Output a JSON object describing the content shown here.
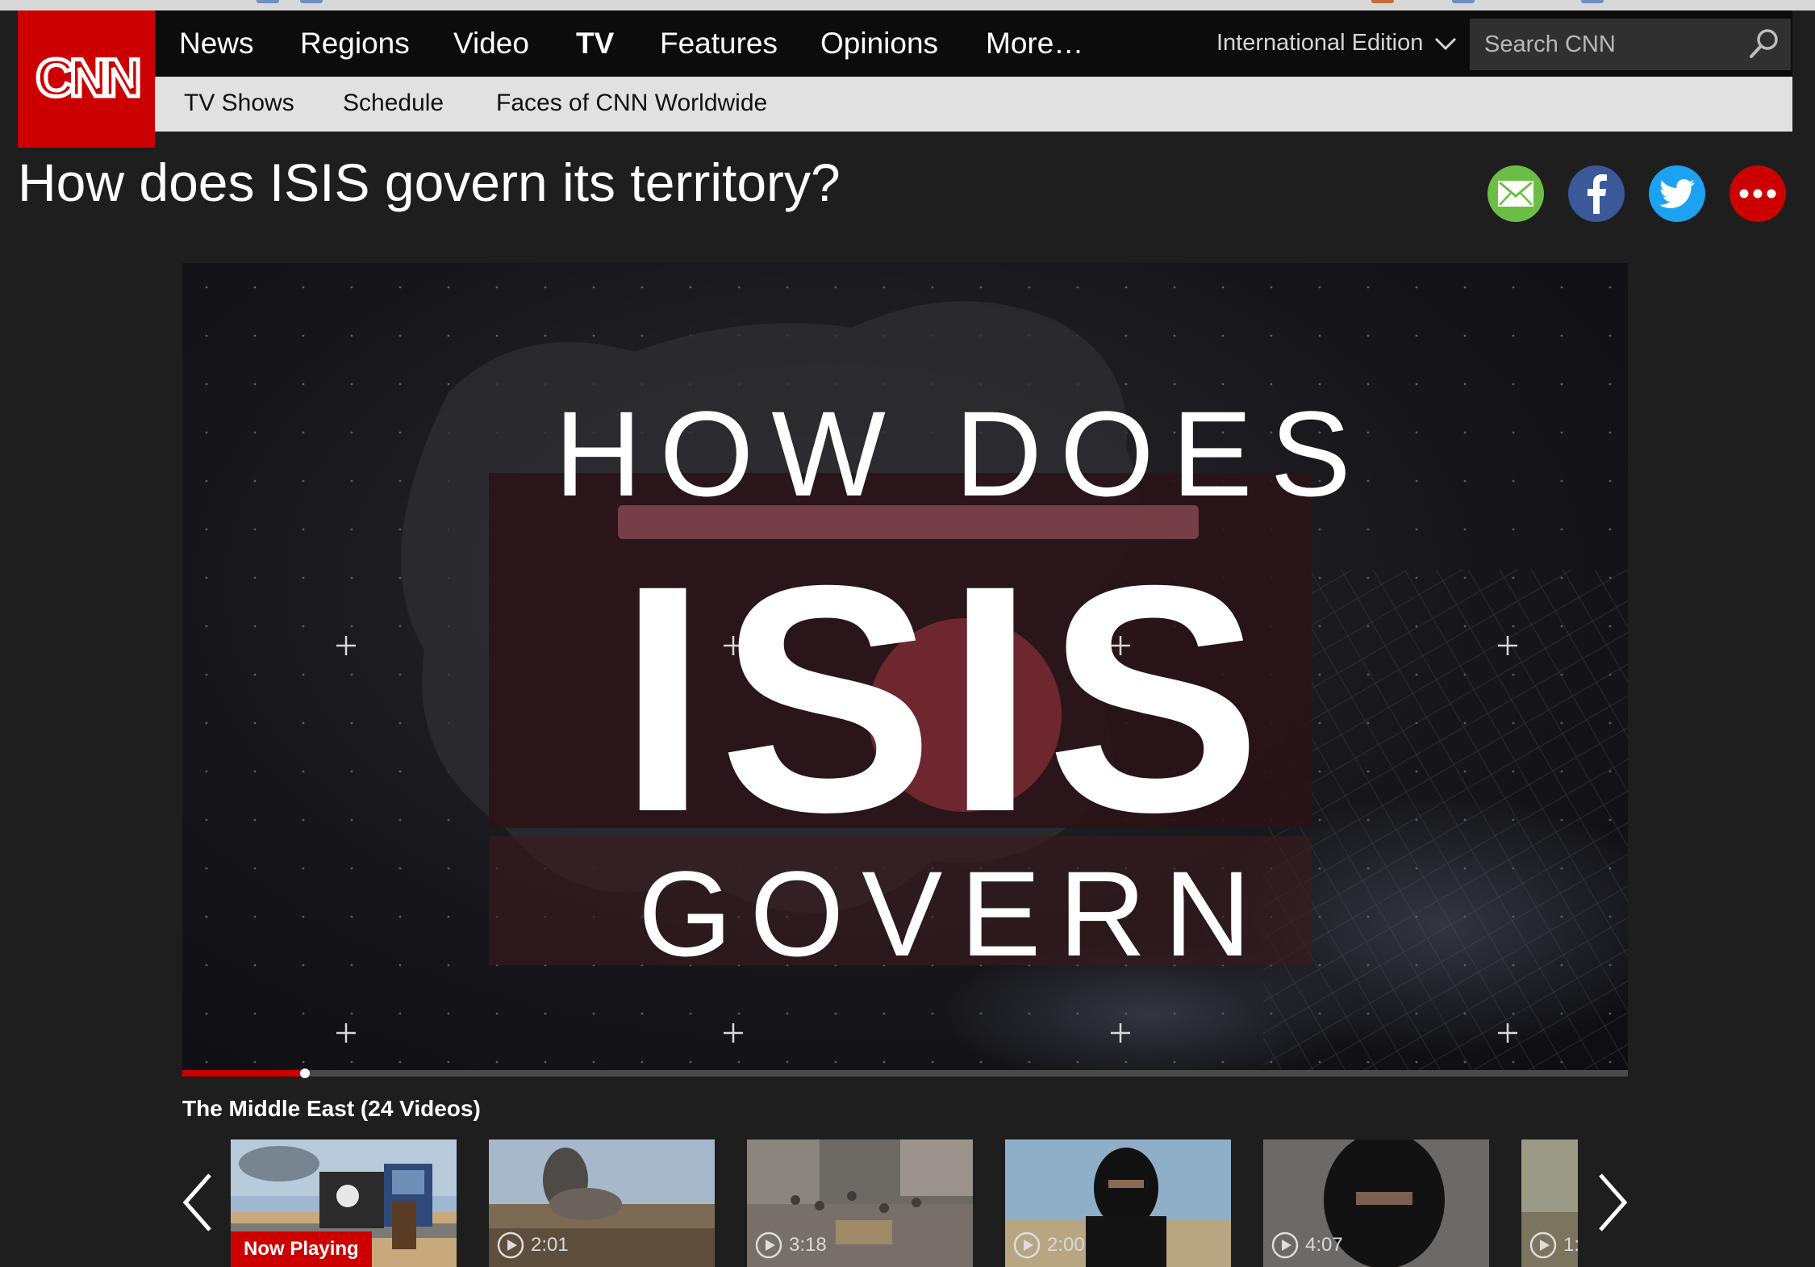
{
  "brand": {
    "logo_text": "CNN",
    "accent": "#cc0000"
  },
  "nav": {
    "items": [
      {
        "label": "News"
      },
      {
        "label": "Regions"
      },
      {
        "label": "Video"
      },
      {
        "label": "TV"
      },
      {
        "label": "Features"
      },
      {
        "label": "Opinions"
      },
      {
        "label": "More…"
      }
    ],
    "active": "TV",
    "edition_label": "International Edition",
    "search_placeholder": "Search CNN"
  },
  "subnav": {
    "items": [
      {
        "label": "TV Shows"
      },
      {
        "label": "Schedule"
      },
      {
        "label": "Faces of CNN Worldwide"
      }
    ]
  },
  "page": {
    "title": "How does ISIS govern its territory?"
  },
  "share": {
    "icons": [
      "email-icon",
      "facebook-icon",
      "twitter-icon",
      "more-icon"
    ],
    "colors": {
      "email": "#6cbd45",
      "facebook": "#3b5998",
      "twitter": "#1da1f2",
      "more": "#cc0000"
    }
  },
  "video": {
    "frame_text": {
      "line1": "HOW DOES",
      "line2": "ISIS",
      "line3": "GOVERN"
    },
    "progress_fraction": 0.085
  },
  "playlist": {
    "title": "The Middle East (24 Videos)",
    "items": [
      {
        "status": "Now Playing",
        "duration": ""
      },
      {
        "status": "",
        "duration": "2:01"
      },
      {
        "status": "",
        "duration": "3:18"
      },
      {
        "status": "",
        "duration": "2:00"
      },
      {
        "status": "",
        "duration": "4:07"
      },
      {
        "status": "",
        "duration": "1:"
      }
    ]
  }
}
